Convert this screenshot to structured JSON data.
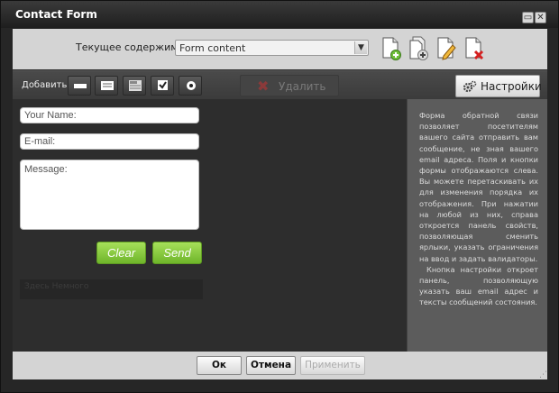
{
  "window": {
    "title": "Contact Form",
    "maximize_icon": "maximize-icon",
    "close_icon": "close-icon"
  },
  "content_selector": {
    "label": "Текущее содержимое:",
    "value": "Form content"
  },
  "content_actions": [
    "add-document-icon",
    "copy-document-icon",
    "edit-document-icon",
    "delete-document-icon"
  ],
  "toolbar": {
    "add_label": "Добавить",
    "add_buttons": [
      "text-field-icon",
      "text-area-icon",
      "select-field-icon",
      "checkbox-icon",
      "radio-icon"
    ],
    "delete_label": "Удалить",
    "settings_label": "Настройки"
  },
  "form": {
    "name_placeholder": "Your Name:",
    "email_placeholder": "E-mail:",
    "message_placeholder": "Message:",
    "clear_label": "Clear",
    "send_label": "Send",
    "status_text": "Здесь Немного"
  },
  "help": {
    "para1": "Форма обратной связи позволяет посетителям вашего сайта отправить вам сообщение, не зная вашего email адреса. Поля и кнопки формы отображаются слева. Вы можете перетаскивать их для изменения порядка их отображения. При нажатии на любой из них, справа откроется панель свойств, позволяющая сменить ярлыки, указать ограничения на ввод и задать валидаторы.",
    "para2": "Кнопка настройки откроет панель, позволяющую указать ваш email адрес и тексты сообщений состояния."
  },
  "dialog_buttons": {
    "ok": "Ок",
    "cancel": "Отмена",
    "apply": "Применить"
  }
}
